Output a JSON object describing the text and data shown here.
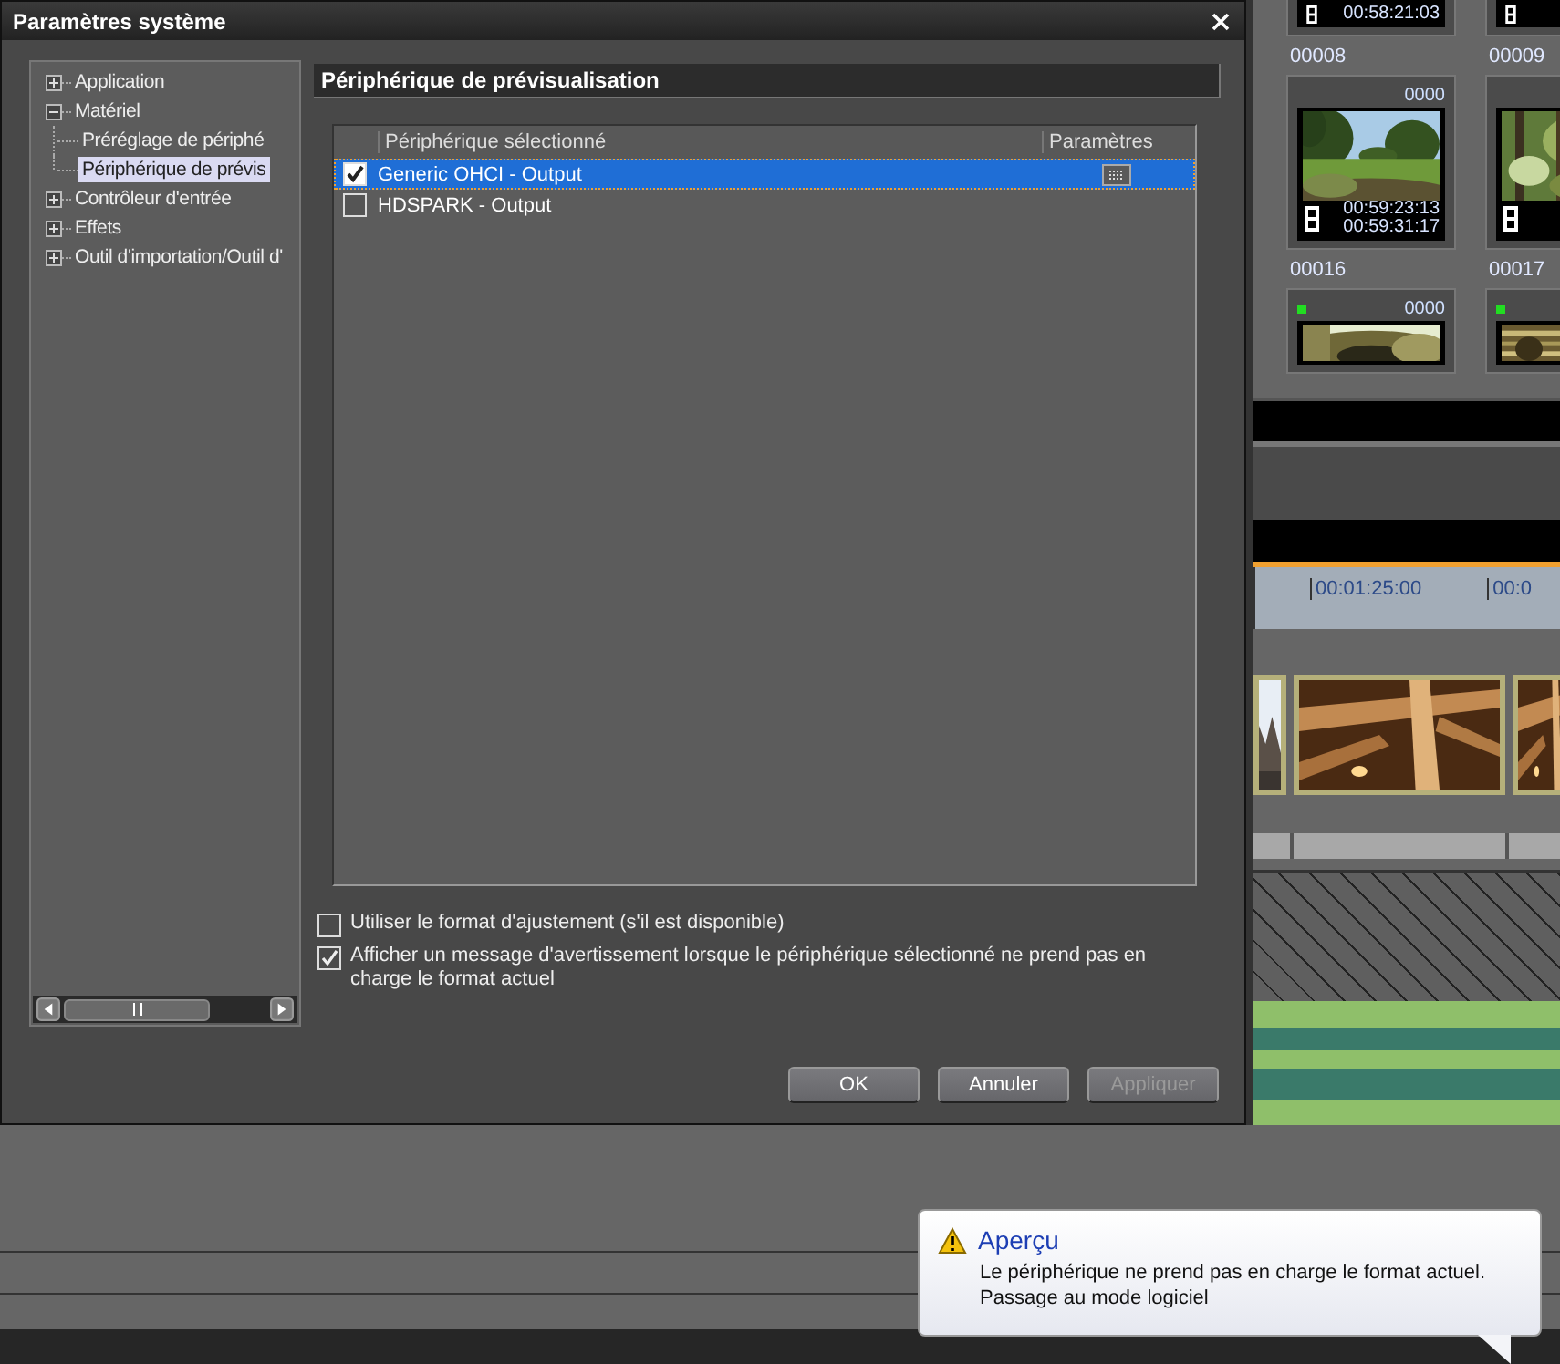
{
  "dialog": {
    "title": "Paramètres système",
    "tree": [
      {
        "label": "Application",
        "expanded": false,
        "selected": false
      },
      {
        "label": "Matériel",
        "expanded": true,
        "selected": false,
        "children": [
          {
            "label": "Préréglage de périphé",
            "selected": false
          },
          {
            "label": "Périphérique de prévis",
            "selected": true
          }
        ]
      },
      {
        "label": "Contrôleur d'entrée",
        "expanded": false,
        "selected": false
      },
      {
        "label": "Effets",
        "expanded": false,
        "selected": false
      },
      {
        "label": "Outil d'importation/Outil d'",
        "expanded": false,
        "selected": false
      }
    ],
    "section_title": "Périphérique de prévisualisation",
    "table": {
      "columns": [
        "Périphérique sélectionné",
        "Paramètres"
      ],
      "rows": [
        {
          "name": "Generic OHCI - Output",
          "checked": true,
          "selected": true,
          "has_settings": true
        },
        {
          "name": "HDSPARK - Output",
          "checked": false,
          "selected": false,
          "has_settings": false
        }
      ]
    },
    "options": [
      {
        "label": "Utiliser le format d'ajustement (s'il est disponible)",
        "checked": false
      },
      {
        "label": "Afficher un message d'avertissement lorsque le périphérique sélectionné ne prend pas en charge le format actuel",
        "checked": true
      }
    ],
    "buttons": [
      {
        "label": "OK",
        "disabled": false
      },
      {
        "label": "Annuler",
        "disabled": false
      },
      {
        "label": "Appliquer",
        "disabled": true
      }
    ]
  },
  "bin": {
    "rows": [
      {
        "kind": "cut-bottom",
        "clips": [
          {
            "label": "00008",
            "timecodes": [
              "00:58:21:03"
            ]
          },
          {
            "label": "00009"
          }
        ]
      },
      {
        "kind": "full",
        "clips": [
          {
            "label": "00016",
            "count": "0000",
            "picture": {
              "kind": "picture"
            },
            "timecodes": [
              "00:59:23:13",
              "00:59:31:17"
            ]
          },
          {
            "label": "00017",
            "picture": {
              "kind": "picture"
            }
          }
        ]
      },
      {
        "kind": "cut-top",
        "clips": [
          {
            "count": "0000",
            "marked": true,
            "picture": {
              "kind": "picture"
            }
          },
          {
            "marked": true,
            "picture": {
              "kind": "picture"
            }
          }
        ]
      }
    ]
  },
  "timeline": {
    "ruler": [
      "00:01:25:00",
      "00:0"
    ],
    "clips": [
      {
        "kind": "picture"
      },
      {
        "kind": "picture"
      },
      {
        "kind": "picture"
      }
    ]
  },
  "balloon": {
    "title": "Aperçu",
    "lines": [
      "Le périphérique ne prend pas en charge le format actuel.",
      "Passage au mode logiciel"
    ]
  }
}
